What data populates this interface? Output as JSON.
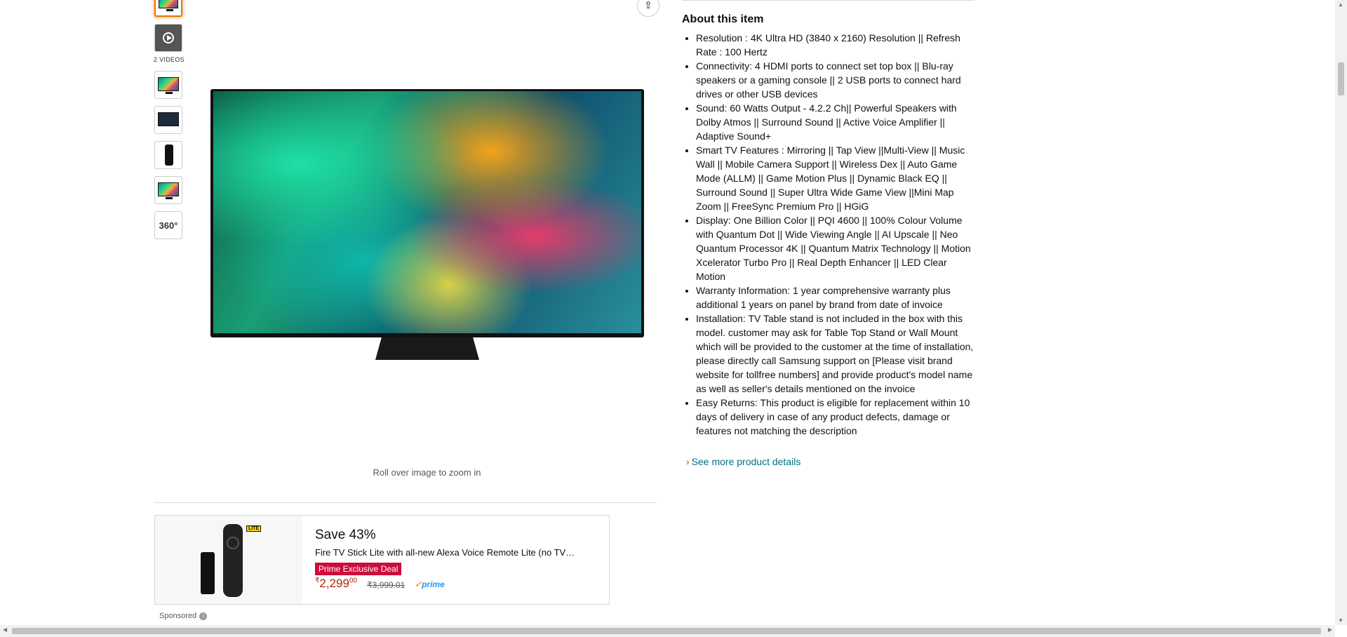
{
  "gallery": {
    "videos_label": "2 VIDEOS",
    "thumb_360_label": "360°"
  },
  "main_image": {
    "zoom_hint": "Roll over image to zoom in"
  },
  "about": {
    "title": "About this item",
    "bullets": [
      "Resolution : 4K Ultra HD (3840 x 2160) Resolution || Refresh Rate : 100 Hertz",
      "Connectivity: 4 HDMI ports to connect set top box || Blu-ray speakers or a gaming console || 2 USB ports to connect hard drives or other USB devices",
      "Sound: 60 Watts Output - 4.2.2 Ch|| Powerful Speakers with Dolby Atmos || Surround Sound || Active Voice Amplifier || Adaptive Sound+",
      "Smart TV Features : Mirroring || Tap View ||Multi-View || Music Wall || Mobile Camera Support || Wireless Dex || Auto Game Mode (ALLM) || Game Motion Plus || Dynamic Black EQ || Surround Sound || Super Ultra Wide Game View ||Mini Map Zoom || FreeSync Premium Pro || HGiG",
      "Display: One Billion Color || PQI 4600 || 100% Colour Volume with Quantum Dot || Wide Viewing Angle || AI Upscale || Neo Quantum Processor 4K || Quantum Matrix Technology || Motion Xcelerator Turbo Pro || Real Depth Enhancer || LED Clear Motion",
      "Warranty Information: 1 year comprehensive warranty plus additional 1 years on panel by brand from date of invoice",
      "Installation: TV Table stand is not included in the box with this model. customer may ask for Table Top Stand or Wall Mount which will be provided to the customer at the time of installation, please directly call Samsung support on [Please visit brand website for tollfree numbers] and provide product's model name as well as seller's details mentioned on the invoice",
      "Easy Returns: This product is eligible for replacement within 10 days of delivery in case of any product defects, damage or features not matching the description"
    ],
    "see_more": "See more product details"
  },
  "ad": {
    "badge": "LITE",
    "title": "Save 43%",
    "subtitle": "Fire TV Stick Lite with all-new Alexa Voice Remote Lite (no TV…",
    "deal_label": "Prime Exclusive Deal",
    "price_symbol": "₹",
    "price_whole": "2,299",
    "price_fraction": "00",
    "list_price": "₹3,999.01",
    "prime_label": "prime",
    "sponsored_label": "Sponsored"
  },
  "icons": {
    "share": "share-icon",
    "info": "info-icon",
    "play": "play-icon",
    "chevron": "chevron-right-icon"
  }
}
